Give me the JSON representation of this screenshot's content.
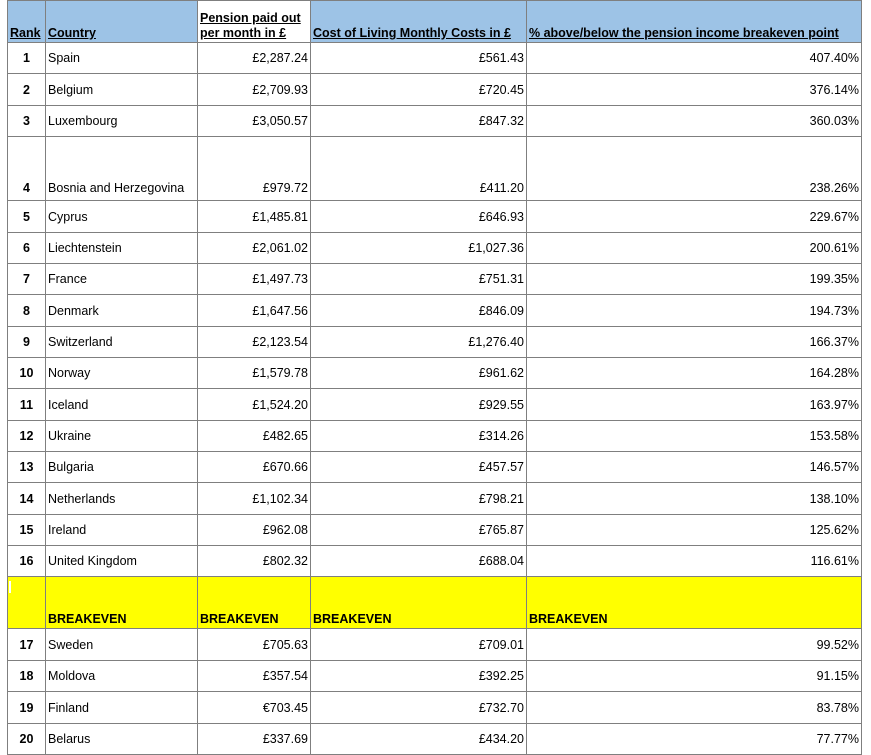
{
  "header": {
    "rank": "Rank",
    "country": "Country",
    "pension_line1": "Pension paid out",
    "pension_line2": "per month in £",
    "cost": "Cost of Living Monthly Costs in £",
    "percent": "% above/below the pension income breakeven point"
  },
  "rows_above": [
    {
      "rank": "1",
      "country": "Spain",
      "pension": "£2,287.24",
      "cost": "£561.43",
      "percent": "407.40%"
    },
    {
      "rank": "2",
      "country": "Belgium",
      "pension": "£2,709.93",
      "cost": "£720.45",
      "percent": "376.14%"
    },
    {
      "rank": "3",
      "country": "Luxembourg",
      "pension": "£3,050.57",
      "cost": "£847.32",
      "percent": "360.03%"
    },
    {
      "rank": "4",
      "country": "Bosnia and Herzegovina",
      "pension": "£979.72",
      "cost": "£411.20",
      "percent": "238.26%"
    },
    {
      "rank": "5",
      "country": "Cyprus",
      "pension": "£1,485.81",
      "cost": "£646.93",
      "percent": "229.67%"
    },
    {
      "rank": "6",
      "country": "Liechtenstein",
      "pension": "£2,061.02",
      "cost": "£1,027.36",
      "percent": "200.61%"
    },
    {
      "rank": "7",
      "country": "France",
      "pension": "£1,497.73",
      "cost": "£751.31",
      "percent": "199.35%"
    },
    {
      "rank": "8",
      "country": "Denmark",
      "pension": "£1,647.56",
      "cost": "£846.09",
      "percent": "194.73%"
    },
    {
      "rank": "9",
      "country": "Switzerland",
      "pension": "£2,123.54",
      "cost": "£1,276.40",
      "percent": "166.37%"
    },
    {
      "rank": "10",
      "country": "Norway",
      "pension": "£1,579.78",
      "cost": "£961.62",
      "percent": "164.28%"
    },
    {
      "rank": "11",
      "country": "Iceland",
      "pension": "£1,524.20",
      "cost": "£929.55",
      "percent": "163.97%"
    },
    {
      "rank": "12",
      "country": "Ukraine",
      "pension": "£482.65",
      "cost": "£314.26",
      "percent": "153.58%"
    },
    {
      "rank": "13",
      "country": "Bulgaria",
      "pension": "£670.66",
      "cost": "£457.57",
      "percent": "146.57%"
    },
    {
      "rank": "14",
      "country": "Netherlands",
      "pension": "£1,102.34",
      "cost": "£798.21",
      "percent": "138.10%"
    },
    {
      "rank": "15",
      "country": "Ireland",
      "pension": "£962.08",
      "cost": "£765.87",
      "percent": "125.62%"
    },
    {
      "rank": "16",
      "country": "United Kingdom",
      "pension": "£802.32",
      "cost": "£688.04",
      "percent": "116.61%"
    }
  ],
  "breakeven": {
    "country": "BREAKEVEN",
    "pension": "BREAKEVEN",
    "cost": "BREAKEVEN",
    "percent": "BREAKEVEN"
  },
  "rows_below": [
    {
      "rank": "17",
      "country": "Sweden",
      "pension": "£705.63",
      "cost": "£709.01",
      "percent": "99.52%"
    },
    {
      "rank": "18",
      "country": "Moldova",
      "pension": "£357.54",
      "cost": "£392.25",
      "percent": "91.15%"
    },
    {
      "rank": "19",
      "country": "Finland",
      "pension": "€703.45",
      "cost": "£732.70",
      "percent": "83.78%"
    },
    {
      "rank": "20",
      "country": "Belarus",
      "pension": "£337.69",
      "cost": "£434.20",
      "percent": "77.77%"
    }
  ],
  "colors": {
    "header_blue": "#9dc3e6",
    "breakeven_yellow": "#ffff00",
    "grid": "#7f7f7f"
  }
}
